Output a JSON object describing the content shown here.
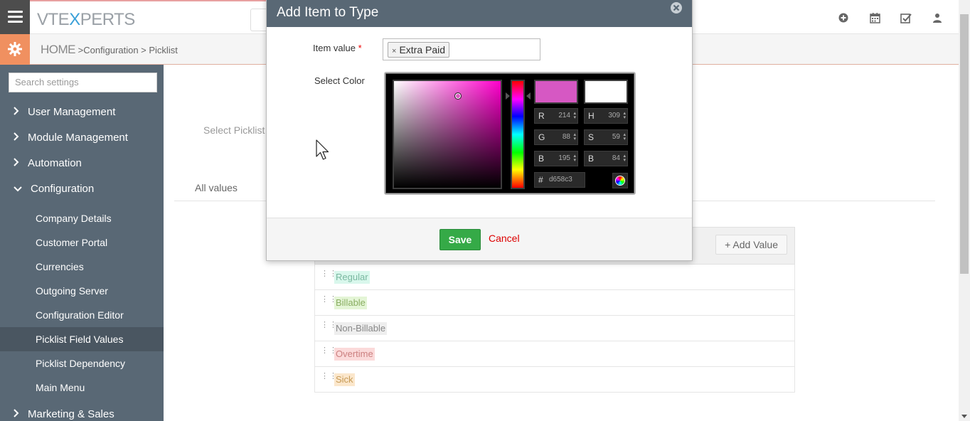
{
  "header": {
    "logo_left": "VT",
    "logo_x": "E",
    "logo_xx": "X",
    "logo_right": "PERTS",
    "icons": [
      "plus-circle-icon",
      "calendar-icon",
      "check-square-icon",
      "user-icon"
    ]
  },
  "breadcrumb": {
    "home": "HOME",
    "sep1": " >",
    "item1": "Configuration",
    "sep2": " > ",
    "item2": "Picklist"
  },
  "sidebar": {
    "search_placeholder": "Search settings",
    "sections": [
      {
        "label": "User Management",
        "chevron": "›"
      },
      {
        "label": "Module Management",
        "chevron": "›"
      },
      {
        "label": "Automation",
        "chevron": "›"
      },
      {
        "label": "Configuration",
        "chevron": "⌄"
      }
    ],
    "sub_items": [
      {
        "label": "Company Details"
      },
      {
        "label": "Customer Portal"
      },
      {
        "label": "Currencies"
      },
      {
        "label": "Outgoing Server"
      },
      {
        "label": "Configuration Editor"
      },
      {
        "label": "Picklist Field Values"
      },
      {
        "label": "Picklist Dependency"
      },
      {
        "label": "Main Menu"
      }
    ],
    "bottom_section": {
      "label": "Marketing & Sales"
    }
  },
  "main": {
    "select_picklist_label": "Select Picklist",
    "all_values_tab": "All values",
    "add_value_label": "+ Add Value",
    "rows": [
      {
        "label": "Regular",
        "bg": "#d9f7ec",
        "fg": "#7ab8a0"
      },
      {
        "label": "Billable",
        "bg": "#e4f5d6",
        "fg": "#8aae62"
      },
      {
        "label": "Non-Billable",
        "bg": "#eeeeee",
        "fg": "#888888"
      },
      {
        "label": "Overtime",
        "bg": "#fbdada",
        "fg": "#cc8080"
      },
      {
        "label": "Sick",
        "bg": "#fbe7cc",
        "fg": "#c69a55"
      }
    ]
  },
  "modal": {
    "title": "Add Item to Type",
    "item_value_label": "Item value",
    "required_mark": "*",
    "tag_value": "Extra Paid",
    "tag_remove": "×",
    "select_color_label": "Select Color",
    "color_picker": {
      "r": "214",
      "g": "88",
      "b_rgb": "195",
      "h": "309",
      "s": "59",
      "b_hsb": "84",
      "hex": "d658c3",
      "new_color": "#d658c3",
      "current_color": "#ffffff",
      "label_r": "R",
      "label_g": "G",
      "label_b": "B",
      "label_h": "H",
      "label_s": "S",
      "label_bb": "B",
      "label_hex": "#"
    },
    "save_label": "Save",
    "cancel_label": "Cancel"
  }
}
